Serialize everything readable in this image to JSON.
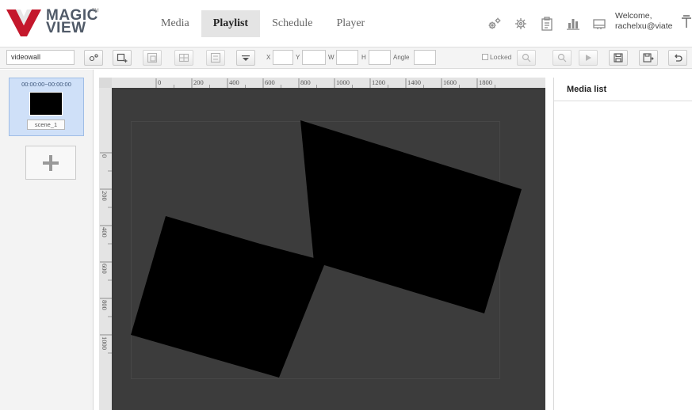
{
  "app": {
    "brand_line1": "MAGIC",
    "brand_line2": "VIEW",
    "brand_mark": "TM",
    "brand_color": "#c4182c"
  },
  "nav": {
    "tabs": [
      {
        "label": "Media",
        "active": false
      },
      {
        "label": "Playlist",
        "active": true
      },
      {
        "label": "Schedule",
        "active": false
      },
      {
        "label": "Player",
        "active": false
      }
    ]
  },
  "header_icons": [
    "settings-gears-icon",
    "gear-icon",
    "clipboard-icon",
    "bar-chart-icon",
    "monitor-icon"
  ],
  "user": {
    "welcome": "Welcome,",
    "email": "rachelxu@viate"
  },
  "toolbar": {
    "name_value": "videowall",
    "x_label": "X",
    "y_label": "Y",
    "w_label": "W",
    "h_label": "H",
    "angle_label": "Angle",
    "x_value": "",
    "y_value": "",
    "w_value": "",
    "h_value": "",
    "angle_value": "",
    "locked_label": "Locked"
  },
  "scenes": [
    {
      "time": "00:00:00~00:00:00",
      "label": "scene_1",
      "selected": true
    }
  ],
  "ruler": {
    "top_labels": [
      "0",
      "200",
      "400",
      "600",
      "800",
      "1000",
      "1200",
      "1400",
      "1600",
      "1800"
    ],
    "left_labels": [
      "0",
      "200",
      "400",
      "600",
      "800",
      "1000"
    ]
  },
  "media_panel": {
    "title": "Media list"
  },
  "colors": {
    "canvas_bg": "#3c3c3c",
    "screen_fill": "#000000",
    "active_tab_bg": "#e4e4e4",
    "scene_selected_bg": "#cfe0f8"
  }
}
